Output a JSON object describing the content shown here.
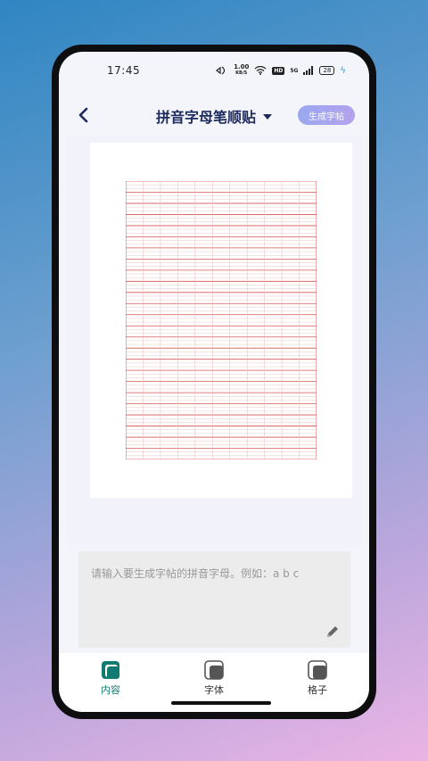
{
  "status": {
    "time": "17:45",
    "net_speed_value": "1.00",
    "net_speed_unit": "KB/S",
    "hd": "HD",
    "signal": "5G",
    "battery": "28"
  },
  "header": {
    "title": "拼音字母笔顺贴",
    "generate_label": "生成字帖"
  },
  "input": {
    "placeholder": "请输入要生成字帖的拼音字母。例如：a b c"
  },
  "tabs": [
    {
      "label": "内容",
      "icon": "content-icon",
      "active": true
    },
    {
      "label": "字体",
      "icon": "font-icon",
      "active": false
    },
    {
      "label": "格子",
      "icon": "grid-icon",
      "active": false
    }
  ],
  "colors": {
    "accent": "#127b71",
    "title": "#1d2a5c",
    "grid_red": "#d9534f",
    "grid_faint": "#e6b9b9"
  }
}
